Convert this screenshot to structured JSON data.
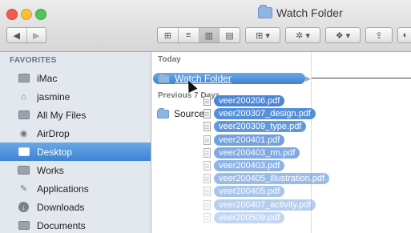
{
  "window": {
    "title": "Watch Folder"
  },
  "toolbar": {
    "back_label": "◀",
    "forward_label": "▶",
    "view_icons": "⊞",
    "view_list": "≡",
    "view_columns": "▥",
    "view_coverflow": "▤",
    "arrange_label": "⊞ ▾",
    "action_label": "✲ ▾",
    "dropbox_label": "❖ ▾",
    "share_label": "⇪",
    "ext_label": "◐"
  },
  "sidebar": {
    "heading": "FAVORITES",
    "items": [
      {
        "label": "iMac",
        "icon": "imac-icon"
      },
      {
        "label": "jasmine",
        "icon": "home-icon"
      },
      {
        "label": "All My Files",
        "icon": "all-files-icon"
      },
      {
        "label": "AirDrop",
        "icon": "airdrop-icon"
      },
      {
        "label": "Desktop",
        "icon": "desktop-icon",
        "selected": true
      },
      {
        "label": "Works",
        "icon": "folder-icon"
      },
      {
        "label": "Applications",
        "icon": "applications-icon"
      },
      {
        "label": "Downloads",
        "icon": "downloads-icon"
      },
      {
        "label": "Documents",
        "icon": "documents-icon"
      }
    ]
  },
  "content": {
    "group_today": "Today",
    "group_previous": "Previous 7 Days",
    "watch_folder": "Watch Folder",
    "source_folder": "Source"
  },
  "dragged_files": [
    "veer200206.pdf",
    "veer200307_design.pdf",
    "veer200309_type.pdf",
    "veer200401.pdf",
    "veer200403_rm.pdf",
    "veer200403.pdf",
    "veer200405_illustration.pdf",
    "veer200405.pdf",
    "veer200407_activity.pdf",
    "veer200509.pdf"
  ],
  "colors": {
    "selection": "#3c83d3",
    "drag_pill": "#4a87d6",
    "sidebar_bg": "#e3e8ee"
  }
}
